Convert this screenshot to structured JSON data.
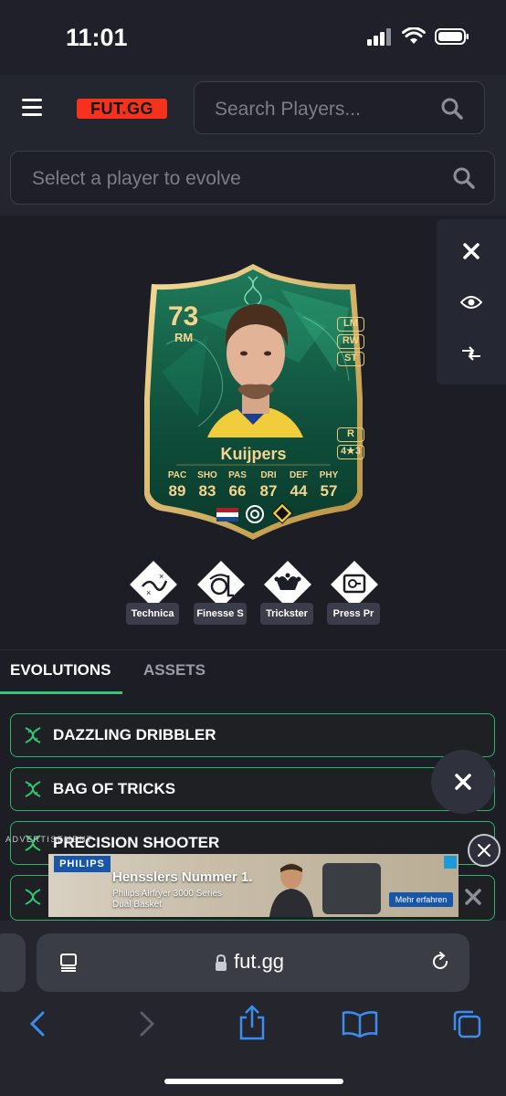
{
  "status_bar": {
    "time": "11:01"
  },
  "header": {
    "logo": "FUT.GG",
    "search_placeholder": "Search Players...",
    "evolve_placeholder": "Select a player to evolve"
  },
  "card": {
    "rating": "73",
    "position": "RM",
    "alt_positions": [
      "LM",
      "RW",
      "ST"
    ],
    "foot": "R",
    "skill_weak": "4★3",
    "name": "Kuijpers",
    "stats": [
      {
        "label": "PAC",
        "value": "89"
      },
      {
        "label": "SHO",
        "value": "83"
      },
      {
        "label": "PAS",
        "value": "66"
      },
      {
        "label": "DRI",
        "value": "87"
      },
      {
        "label": "DEF",
        "value": "44"
      },
      {
        "label": "PHY",
        "value": "57"
      }
    ]
  },
  "playstyles": [
    "Technica",
    "Finesse S",
    "Trickster",
    "Press Pr"
  ],
  "tabs": {
    "active": "EVOLUTIONS",
    "inactive": "ASSETS"
  },
  "evolutions": [
    "DAZZLING DRIBBLER",
    "BAG OF TRICKS",
    "PRECISION SHOOTER"
  ],
  "ad": {
    "label": "ADVERTISEMENT",
    "brand": "PHILIPS",
    "title": "Hensslers Nummer 1.",
    "subtitle": "Philips Airfryer 3000 Series Dual Basket",
    "cta": "Mehr erfahren"
  },
  "browser": {
    "url": "fut.gg"
  },
  "colors": {
    "accent_green": "#2ec971",
    "gold": "#f3d58e",
    "brand_red": "#f7321c"
  }
}
